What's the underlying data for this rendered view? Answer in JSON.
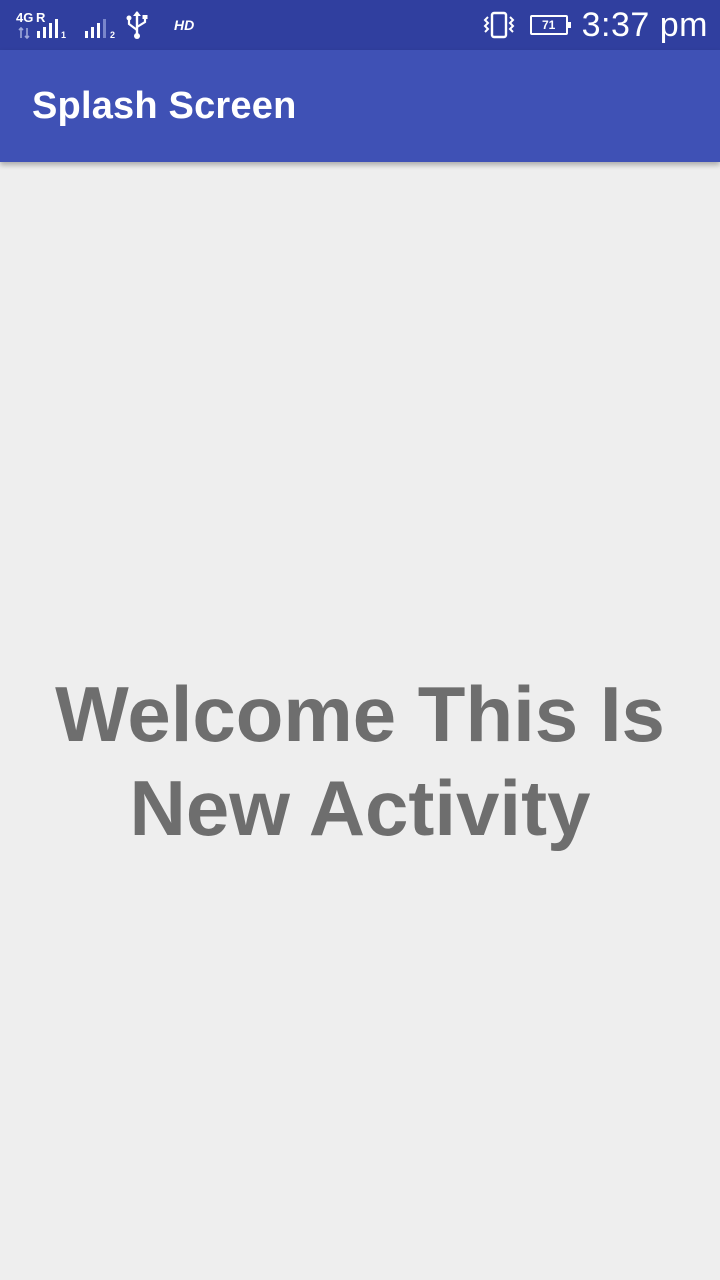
{
  "status_bar": {
    "network_type": "4G",
    "roaming": "R",
    "sim1_index": "1",
    "sim2_index": "2",
    "hd": "HD",
    "battery": "71",
    "time": "3:37 pm"
  },
  "app_bar": {
    "title": "Splash Screen"
  },
  "main": {
    "message": "Welcome This Is New Activity"
  },
  "colors": {
    "status_bar": "#303f9f",
    "app_bar": "#3f51b5",
    "background": "#eeeeee",
    "message_text": "#6e6e6e"
  }
}
